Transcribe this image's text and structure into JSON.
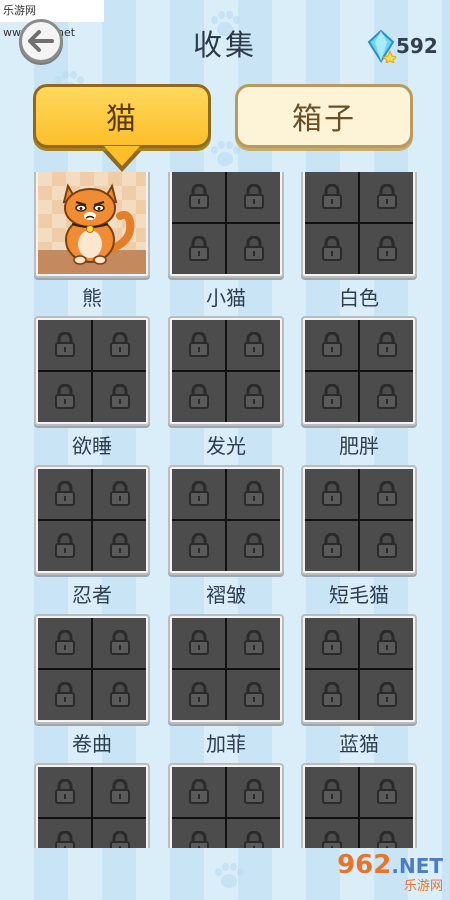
{
  "watermark": "乐游网 www.962.net",
  "header": {
    "title": "收集",
    "gem_count": "592"
  },
  "tabs": [
    {
      "label": "猫",
      "active": true
    },
    {
      "label": "箱子",
      "active": false
    }
  ],
  "items": [
    {
      "label": "熊",
      "unlocked": true
    },
    {
      "label": "小猫",
      "unlocked": false
    },
    {
      "label": "白色",
      "unlocked": false
    },
    {
      "label": "欲睡",
      "unlocked": false
    },
    {
      "label": "发光",
      "unlocked": false
    },
    {
      "label": "肥胖",
      "unlocked": false
    },
    {
      "label": "忍者",
      "unlocked": false
    },
    {
      "label": "褶皱",
      "unlocked": false
    },
    {
      "label": "短毛猫",
      "unlocked": false
    },
    {
      "label": "卷曲",
      "unlocked": false
    },
    {
      "label": "加菲",
      "unlocked": false
    },
    {
      "label": "蓝猫",
      "unlocked": false
    },
    {
      "label": "",
      "unlocked": false
    },
    {
      "label": "",
      "unlocked": false
    },
    {
      "label": "",
      "unlocked": false
    }
  ],
  "logo": {
    "brand_num": "962",
    "brand_tld": ".NET",
    "brand_cn": "乐游网"
  },
  "colors": {
    "tab_active": "#fcbf2b",
    "tab_inactive": "#fdf3d7",
    "locked_cell": "#4c4c4c",
    "background": "#d9eef9"
  },
  "icons": {
    "back": "arrow-left-icon",
    "gem": "diamond-icon",
    "lock": "padlock-icon"
  }
}
